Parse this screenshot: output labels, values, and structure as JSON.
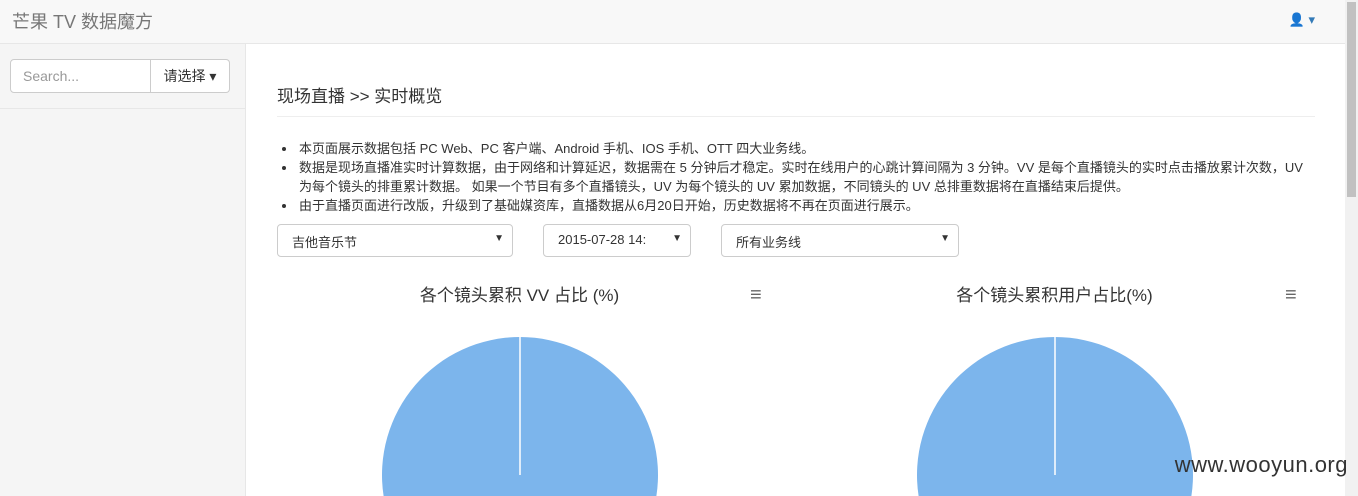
{
  "header": {
    "brand": "芒果 TV 数据魔方",
    "user_icon": "user-icon"
  },
  "sidebar": {
    "search_placeholder": "Search...",
    "select_label": "请选择 ▾"
  },
  "main": {
    "breadcrumb": "现场直播 >> 实时概览",
    "notes": [
      "本页面展示数据包括 PC Web、PC 客户端、Android 手机、IOS 手机、OTT 四大业务线。",
      "数据是现场直播准实时计算数据，由于网络和计算延迟，数据需在 5 分钟后才稳定。实时在线用户的心跳计算间隔为 3 分钟。VV 是每个直播镜头的实时点击播放累计次数，UV 为每个镜头的排重累计数据。 如果一个节目有多个直播镜头，UV 为每个镜头的 UV 累加数据，不同镜头的 UV 总排重数据将在直播结束后提供。",
      "由于直播页面进行改版，升级到了基础媒资库，直播数据从6月20日开始，历史数据将不再在页面进行展示。"
    ],
    "filters": {
      "program": "吉他音乐节",
      "time": "2015-07-28 14:",
      "business": "所有业务线"
    }
  },
  "chart_data": [
    {
      "type": "pie",
      "title": "各个镜头累积 VV 占比 (%)",
      "values": [
        100
      ],
      "color": "#7cb5ec"
    },
    {
      "type": "pie",
      "title": "各个镜头累积用户占比(%)",
      "values": [
        100
      ],
      "color": "#7cb5ec"
    }
  ],
  "watermark": "www.wooyun.org"
}
